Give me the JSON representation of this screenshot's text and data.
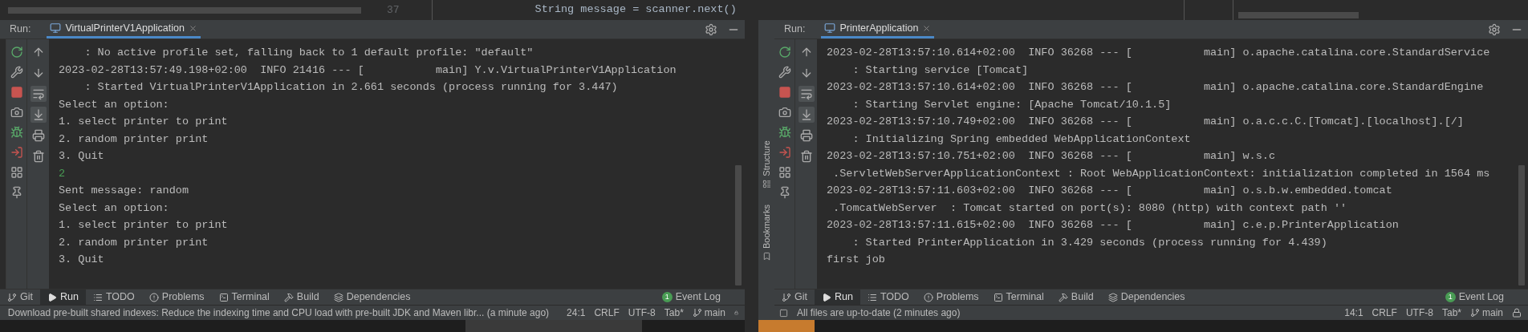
{
  "editor_strip": {
    "line_number": "37",
    "code": "String message = scanner.next()"
  },
  "panes": [
    {
      "run_label": "Run:",
      "tab": {
        "title": "VirtualPrinterV1Application"
      },
      "soft_wrap_on": true,
      "scroll_to_end_on": true,
      "console": [
        {
          "kind": "output",
          "text": "    : No active profile set, falling back to 1 default profile: \"default\""
        },
        {
          "kind": "output",
          "text": "2023-02-28T13:57:49.198+02:00  INFO 21416 --- [           main] Y.v.VirtualPrinterV1Application"
        },
        {
          "kind": "output",
          "text": "    : Started VirtualPrinterV1Application in 2.661 seconds (process running for 3.447)"
        },
        {
          "kind": "output",
          "text": "Select an option:"
        },
        {
          "kind": "output",
          "text": "1. select printer to print"
        },
        {
          "kind": "output",
          "text": "2. random printer print"
        },
        {
          "kind": "output",
          "text": "3. Quit"
        },
        {
          "kind": "input",
          "text": "2"
        },
        {
          "kind": "output",
          "text": "Sent message: random"
        },
        {
          "kind": "output",
          "text": "Select an option:"
        },
        {
          "kind": "output",
          "text": "1. select printer to print"
        },
        {
          "kind": "output",
          "text": "2. random printer print"
        },
        {
          "kind": "output",
          "text": "3. Quit"
        }
      ],
      "tool_tabs": [
        {
          "label": "Git",
          "selected": false
        },
        {
          "label": "Run",
          "selected": true
        },
        {
          "label": "TODO",
          "selected": false
        },
        {
          "label": "Problems",
          "selected": false
        },
        {
          "label": "Terminal",
          "selected": false
        },
        {
          "label": "Build",
          "selected": false
        },
        {
          "label": "Dependencies",
          "selected": false
        }
      ],
      "event_log": {
        "badge": "1",
        "label": "Event Log"
      },
      "status": {
        "message": "Download pre-built shared indexes: Reduce the indexing time and CPU load with pre-built JDK and Maven libr... (a minute ago)",
        "position": "24:1",
        "line_separator": "CRLF",
        "encoding": "UTF-8",
        "indent": "Tab*",
        "branch": "main"
      }
    },
    {
      "run_label": "Run:",
      "tab": {
        "title": "PrinterApplication"
      },
      "side_tabs": [
        "Structure",
        "Bookmarks"
      ],
      "soft_wrap_on": true,
      "scroll_to_end_on": true,
      "console": [
        {
          "kind": "output",
          "text": "2023-02-28T13:57:10.614+02:00  INFO 36268 --- [           main] o.apache.catalina.core.StandardService"
        },
        {
          "kind": "output",
          "text": "    : Starting service [Tomcat]"
        },
        {
          "kind": "output",
          "text": "2023-02-28T13:57:10.614+02:00  INFO 36268 --- [           main] o.apache.catalina.core.StandardEngine"
        },
        {
          "kind": "output",
          "text": "    : Starting Servlet engine: [Apache Tomcat/10.1.5]"
        },
        {
          "kind": "output",
          "text": "2023-02-28T13:57:10.749+02:00  INFO 36268 --- [           main] o.a.c.c.C.[Tomcat].[localhost].[/]"
        },
        {
          "kind": "output",
          "text": "    : Initializing Spring embedded WebApplicationContext"
        },
        {
          "kind": "output",
          "text": "2023-02-28T13:57:10.751+02:00  INFO 36268 --- [           main] w.s.c"
        },
        {
          "kind": "output",
          "text": " .ServletWebServerApplicationContext : Root WebApplicationContext: initialization completed in 1564 ms"
        },
        {
          "kind": "output",
          "text": "2023-02-28T13:57:11.603+02:00  INFO 36268 --- [           main] o.s.b.w.embedded.tomcat"
        },
        {
          "kind": "output",
          "text": " .TomcatWebServer  : Tomcat started on port(s): 8080 (http) with context path ''"
        },
        {
          "kind": "output",
          "text": "2023-02-28T13:57:11.615+02:00  INFO 36268 --- [           main] c.e.p.PrinterApplication"
        },
        {
          "kind": "output",
          "text": "    : Started PrinterApplication in 3.429 seconds (process running for 4.439)"
        },
        {
          "kind": "output",
          "text": "first job"
        }
      ],
      "tool_tabs": [
        {
          "label": "Git",
          "selected": false
        },
        {
          "label": "Run",
          "selected": true
        },
        {
          "label": "TODO",
          "selected": false
        },
        {
          "label": "Problems",
          "selected": false
        },
        {
          "label": "Terminal",
          "selected": false
        },
        {
          "label": "Build",
          "selected": false
        },
        {
          "label": "Dependencies",
          "selected": false
        }
      ],
      "event_log": {
        "badge": "1",
        "label": "Event Log"
      },
      "status": {
        "message": "All files are up-to-date (2 minutes ago)",
        "position": "14:1",
        "line_separator": "CRLF",
        "encoding": "UTF-8",
        "indent": "Tab*",
        "branch": "main"
      }
    }
  ]
}
